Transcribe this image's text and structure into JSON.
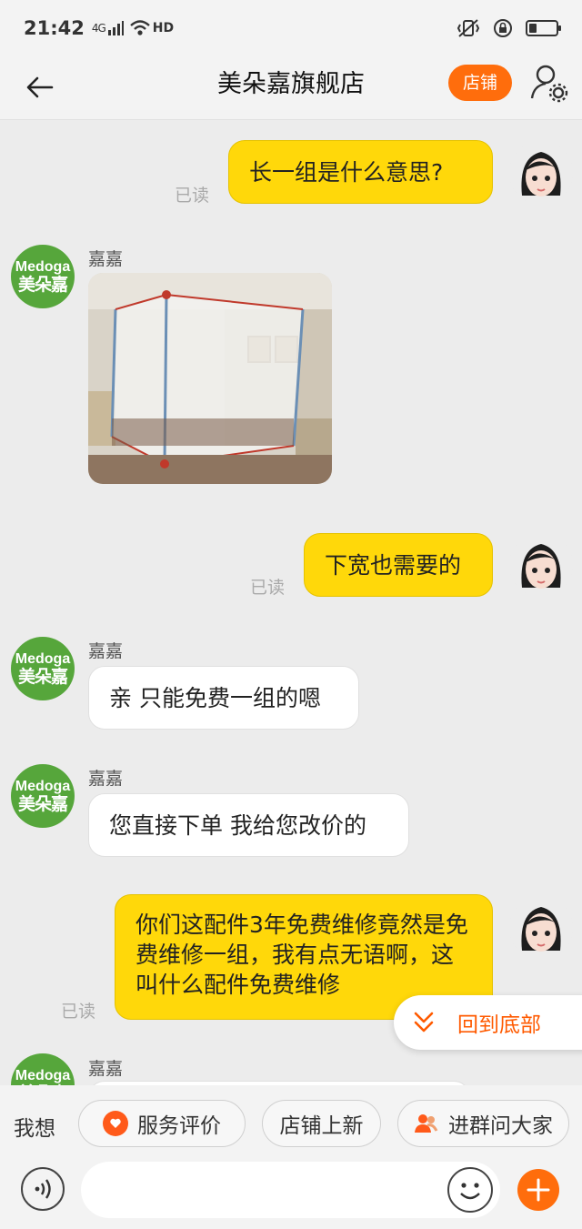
{
  "status_bar": {
    "time": "21:42",
    "network": "4G",
    "hd": "HD"
  },
  "nav": {
    "title": "美朵嘉旗舰店",
    "store_button": "店铺"
  },
  "shop": {
    "avatar_line1": "Medoga",
    "avatar_line2": "美朵嘉",
    "agent_name": "嘉嘉"
  },
  "messages": {
    "m1": {
      "text": "长一组是什么意思?",
      "status": "已读"
    },
    "m3": {
      "text": "下宽也需要的",
      "status": "已读"
    },
    "m4": {
      "text": "亲 只能免费一组的嗯"
    },
    "m5": {
      "text": "您直接下单 我给您改价的"
    },
    "m6": {
      "text": "你们这配件3年免费维修竟然是免费维修一组，我有点无语啊，这叫什么配件免费维修",
      "status": "已读"
    }
  },
  "back_to_bottom": "回到底部",
  "quick": {
    "label": "我想",
    "chips": [
      "服务评价",
      "店铺上新",
      "进群问大家"
    ]
  },
  "input": {
    "placeholder": ""
  },
  "colors": {
    "accent": "#ff6d0c",
    "my_bubble": "#ffd80a",
    "shop_green": "#56a63b"
  }
}
